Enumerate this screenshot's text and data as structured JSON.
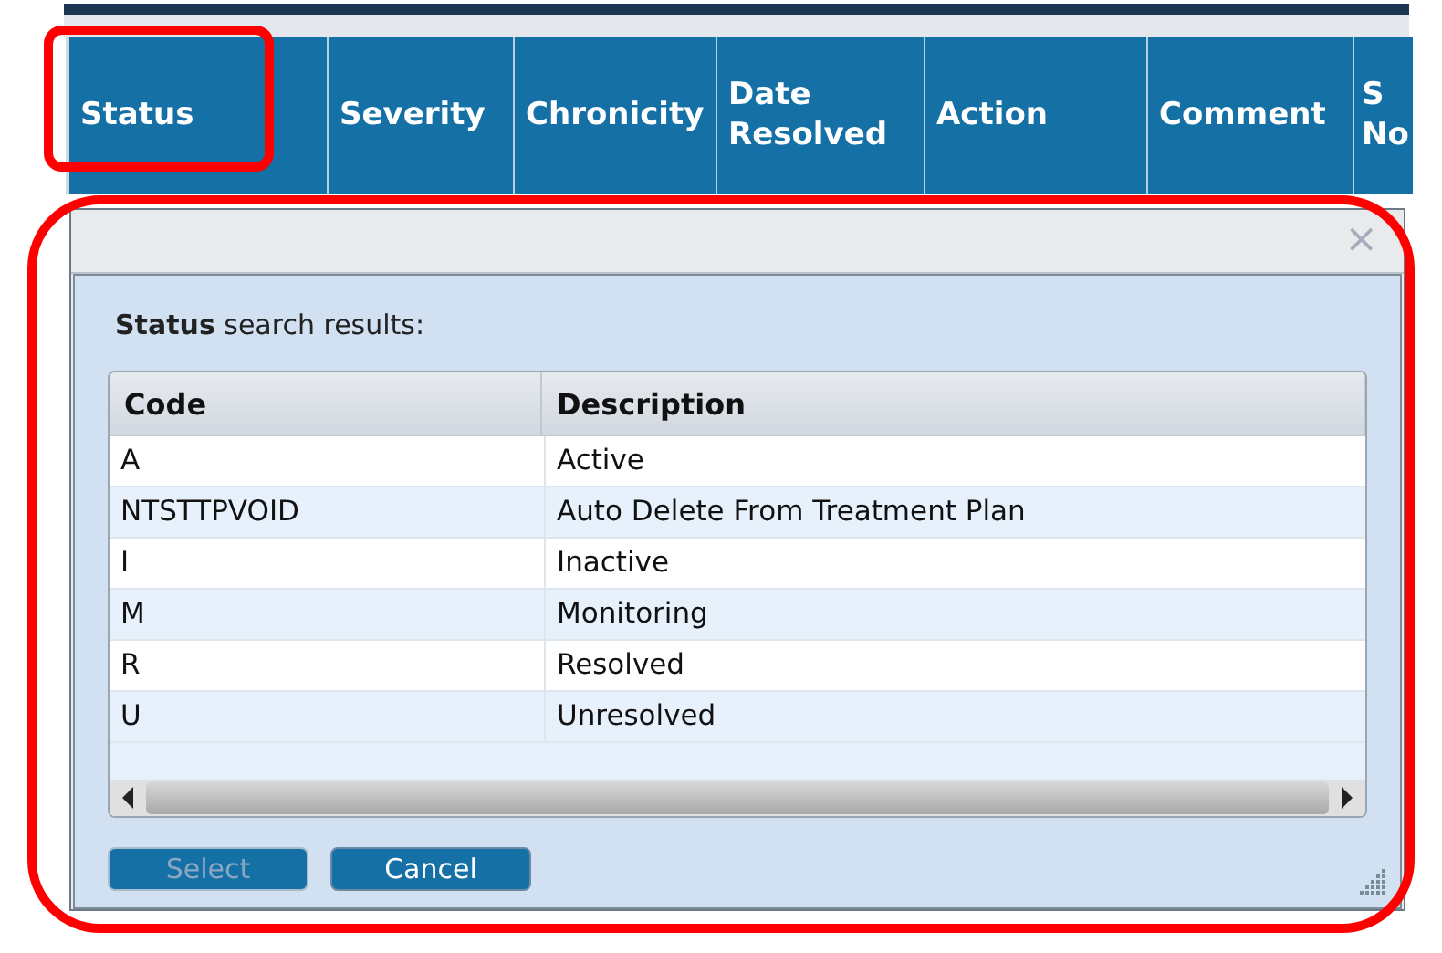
{
  "table": {
    "columns": [
      {
        "label": "Status",
        "highlighted": true
      },
      {
        "label": "Severity",
        "highlighted": false
      },
      {
        "label": "Chronicity",
        "highlighted": false
      },
      {
        "label": "Date Resolved",
        "highlighted": false
      },
      {
        "label": "Action",
        "highlighted": false
      },
      {
        "label": "Comment",
        "highlighted": false
      },
      {
        "label": "S No",
        "highlighted": false
      }
    ]
  },
  "dialog": {
    "highlighted": true,
    "close": "×",
    "heading_bold": "Status",
    "heading": "search results:",
    "grid": {
      "columns": [
        "Code",
        "Description"
      ],
      "rows": [
        {
          "code": "A",
          "description": "Active"
        },
        {
          "code": "NTSTTPVOID",
          "description": "Auto Delete From Treatment Plan"
        },
        {
          "code": "I",
          "description": "Inactive"
        },
        {
          "code": "M",
          "description": "Monitoring"
        },
        {
          "code": "R",
          "description": "Resolved"
        },
        {
          "code": "U",
          "description": "Unresolved"
        }
      ]
    },
    "buttons": [
      {
        "label": "Select",
        "disabled": true
      },
      {
        "label": "Cancel",
        "disabled": false
      }
    ]
  }
}
